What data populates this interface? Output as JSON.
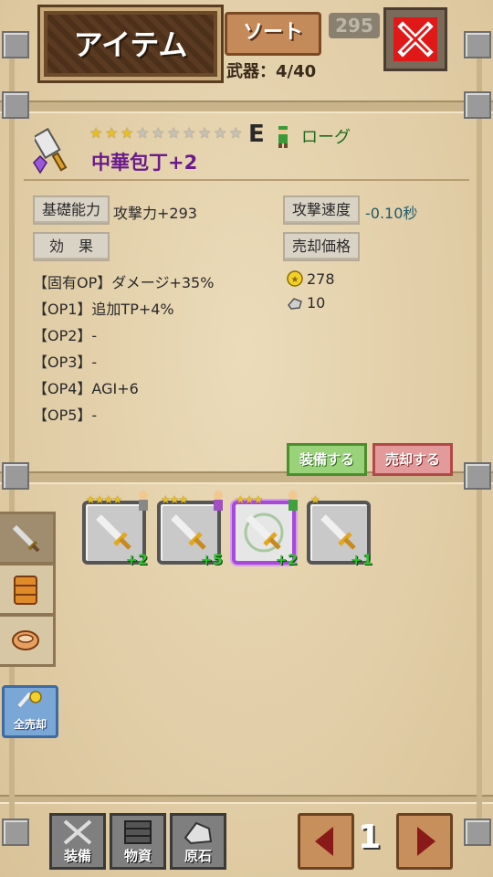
{
  "header": {
    "title": "アイテム",
    "sort_label": "ソート",
    "count_text": "武器：4/40",
    "faded_number": "295"
  },
  "item": {
    "name": "中華包丁+2",
    "stars_filled": 3,
    "stars_total": 10,
    "rank": "E",
    "job": "ローグ"
  },
  "stats": {
    "base_label": "基礎能力",
    "base_value": "攻撃力+293",
    "speed_label": "攻撃速度",
    "speed_value": "-0.10秒",
    "effect_label": "効　果",
    "sell_label": "売却価格",
    "gold": "278",
    "ore": "10"
  },
  "ops": [
    "【固有OP】ダメージ+35%",
    "【OP1】追加TP+4%",
    "【OP2】-",
    "【OP3】-",
    "【OP4】AGI+6",
    "【OP5】-"
  ],
  "actions": {
    "equip": "装備する",
    "sell": "売却する"
  },
  "side": {
    "sell_all": "全売却"
  },
  "inventory": [
    {
      "stars": "★★★★",
      "plus": "+2",
      "selected": false
    },
    {
      "stars": "★★★",
      "plus": "+5",
      "selected": false
    },
    {
      "stars": "★★★",
      "plus": "+2",
      "selected": true
    },
    {
      "stars": "★",
      "plus": "+1",
      "selected": false
    }
  ],
  "bottom": {
    "equip": "装備",
    "materials": "物資",
    "ore": "原石",
    "page": "1"
  },
  "colors": {
    "parchment": "#e8d5ad",
    "item_name": "#6a1a8a",
    "job": "#1e6b1e",
    "speed_value": "#1e5a6b",
    "plus": "#30c030",
    "selected_border": "#a84ad8"
  }
}
